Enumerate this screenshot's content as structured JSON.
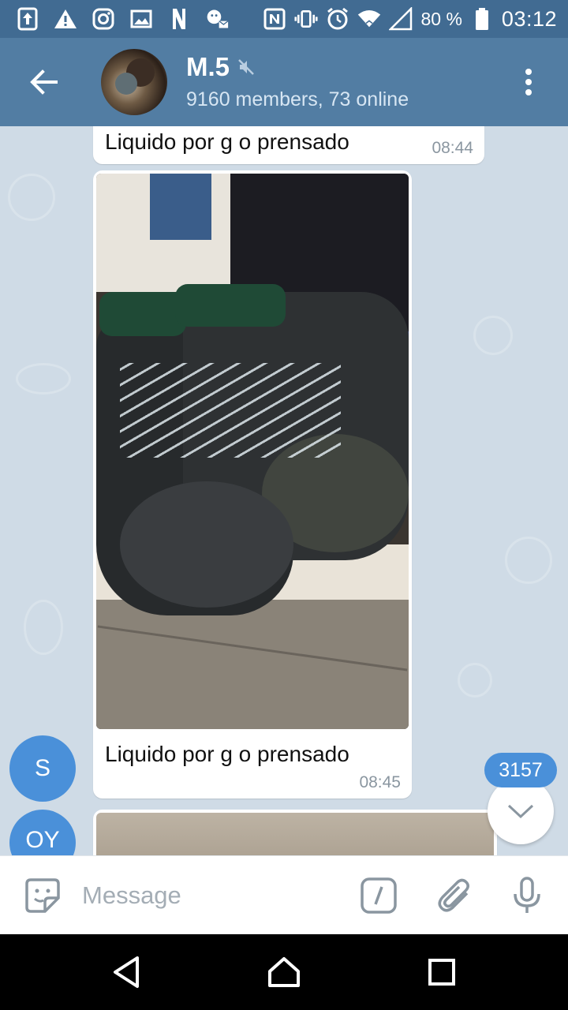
{
  "status_bar": {
    "battery": "80 %",
    "time": "03:12",
    "icons": [
      "upload-icon",
      "warning-icon",
      "instagram-icon",
      "image-icon",
      "n-app-icon",
      "chat-notify-icon",
      "nfc-icon",
      "vibrate-icon",
      "alarm-icon",
      "wifi-icon",
      "signal-icon",
      "battery-icon"
    ]
  },
  "header": {
    "title": "M.5",
    "subtitle": "9160 members, 73 online",
    "muted": true
  },
  "messages": [
    {
      "text": "Liquido por g o prensado",
      "time": "08:44",
      "has_photo": false
    },
    {
      "text": "Liquido por g o prensado",
      "time": "08:45",
      "has_photo": true
    },
    {
      "text": "",
      "time": "",
      "has_photo": true
    }
  ],
  "avatars": {
    "sender1": "S",
    "sender2": "OY"
  },
  "unread_count": "3157",
  "composer": {
    "placeholder": "Message"
  },
  "colors": {
    "header": "#527da3",
    "status_bar": "#416b92",
    "chat_bg": "#cfdbe6",
    "accent": "#4a90d9"
  }
}
